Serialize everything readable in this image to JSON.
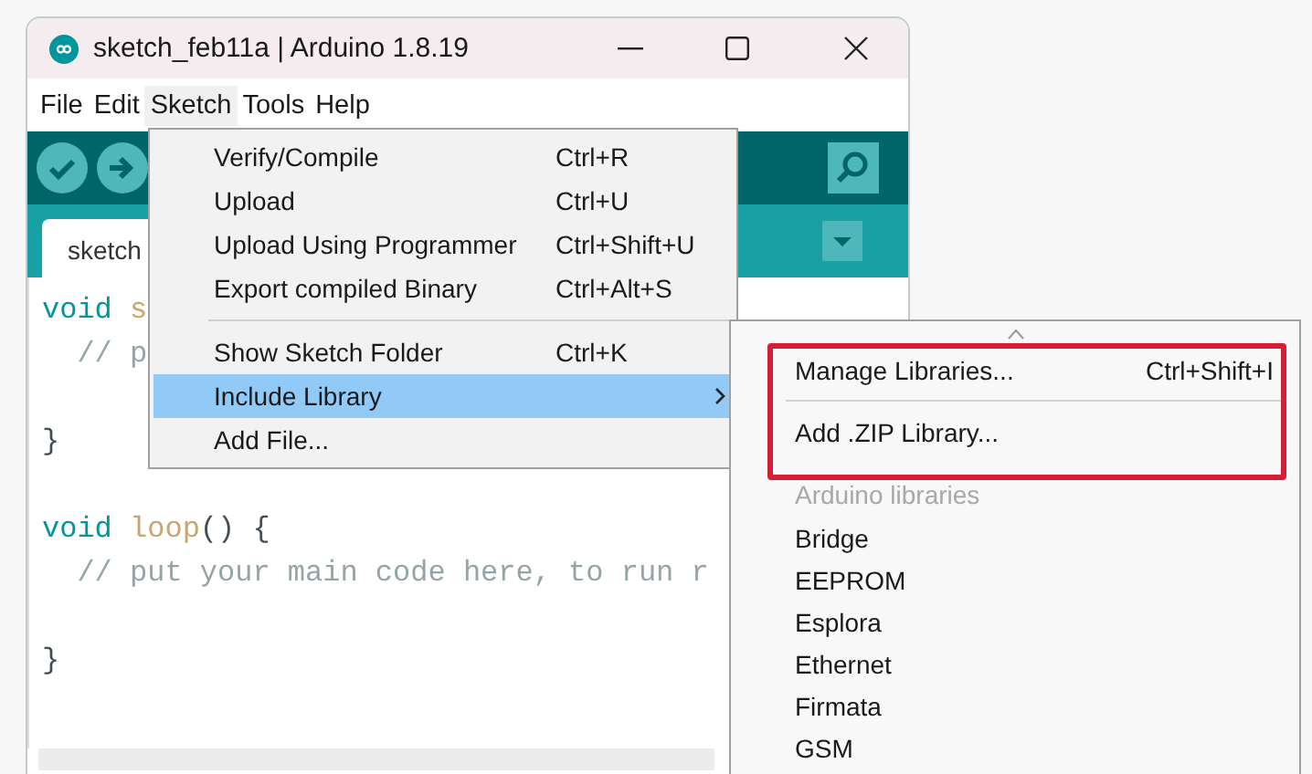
{
  "window": {
    "title": "sketch_feb11a | Arduino 1.8.19"
  },
  "menu_bar": [
    {
      "label": "File",
      "selected": false
    },
    {
      "label": "Edit",
      "selected": false
    },
    {
      "label": "Sketch",
      "selected": true
    },
    {
      "label": "Tools",
      "selected": false
    },
    {
      "label": "Help",
      "selected": false
    }
  ],
  "tabs": [
    {
      "label": "sketch",
      "selected": true
    }
  ],
  "code_lines": [
    {
      "kind": "code",
      "tokens": [
        {
          "kind": "keyword",
          "text": "void"
        },
        {
          "kind": "function",
          "text": " s"
        }
      ]
    },
    {
      "kind": "code",
      "tokens": [
        {
          "kind": "comment",
          "text": "  // p"
        }
      ]
    },
    {
      "kind": "blank"
    },
    {
      "kind": "code",
      "tokens": [
        {
          "kind": "plain",
          "text": "}"
        }
      ]
    },
    {
      "kind": "blank"
    },
    {
      "kind": "code",
      "tokens": [
        {
          "kind": "keyword",
          "text": "void "
        },
        {
          "kind": "function",
          "text": "loop"
        },
        {
          "kind": "plain",
          "text": "() {"
        }
      ]
    },
    {
      "kind": "code",
      "tokens": [
        {
          "kind": "comment",
          "text": "  // put your main code here, to run r"
        }
      ]
    },
    {
      "kind": "blank"
    },
    {
      "kind": "code",
      "tokens": [
        {
          "kind": "plain",
          "text": "}"
        }
      ]
    }
  ],
  "sketch_menu": [
    {
      "kind": "item",
      "label": "Verify/Compile",
      "shortcut": "Ctrl+R",
      "selected": false
    },
    {
      "kind": "item",
      "label": "Upload",
      "shortcut": "Ctrl+U",
      "selected": false
    },
    {
      "kind": "item",
      "label": "Upload Using Programmer",
      "shortcut": "Ctrl+Shift+U",
      "selected": false
    },
    {
      "kind": "item",
      "label": "Export compiled Binary",
      "shortcut": "Ctrl+Alt+S",
      "selected": false
    },
    {
      "kind": "separator"
    },
    {
      "kind": "item",
      "label": "Show Sketch Folder",
      "shortcut": "Ctrl+K",
      "selected": false
    },
    {
      "kind": "submenu",
      "label": "Include Library",
      "selected": true
    },
    {
      "kind": "item",
      "label": "Add File...",
      "selected": false
    }
  ],
  "include_library_menu": [
    {
      "kind": "item",
      "label": "Manage Libraries...",
      "shortcut": "Ctrl+Shift+I"
    },
    {
      "kind": "separator"
    },
    {
      "kind": "item",
      "label": "Add .ZIP Library..."
    },
    {
      "kind": "header",
      "label": "Arduino libraries"
    },
    {
      "kind": "library",
      "label": "Bridge"
    },
    {
      "kind": "library",
      "label": "EEPROM"
    },
    {
      "kind": "library",
      "label": "Esplora"
    },
    {
      "kind": "library",
      "label": "Ethernet"
    },
    {
      "kind": "library",
      "label": "Firmata"
    },
    {
      "kind": "library",
      "label": "GSM"
    }
  ]
}
